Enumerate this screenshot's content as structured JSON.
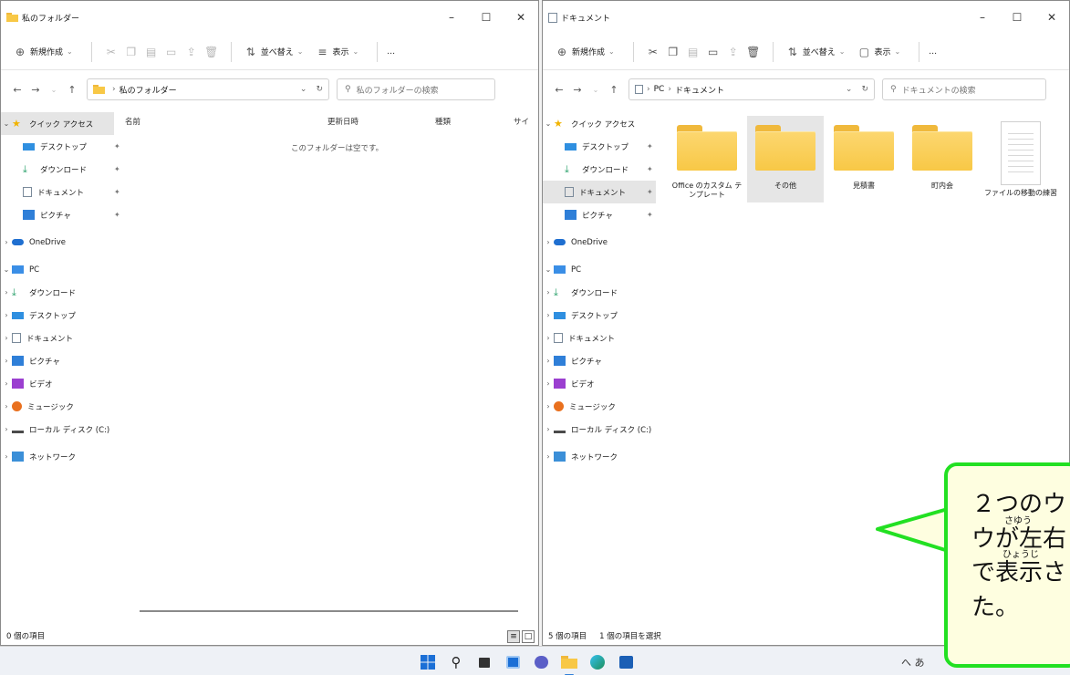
{
  "left_window": {
    "title": "私のフォルダー",
    "toolbar": {
      "new_label": "新規作成",
      "sort_label": "並べ替え",
      "view_label": "表示",
      "more_label": "…"
    },
    "address": {
      "path": [
        "私のフォルダー"
      ],
      "search_placeholder": "私のフォルダーの検索"
    },
    "columns": [
      "名前",
      "更新日時",
      "種類",
      "サイ"
    ],
    "empty_message": "このフォルダーは空です。",
    "status": "0 個の項目"
  },
  "right_window": {
    "title": "ドキュメント",
    "toolbar": {
      "new_label": "新規作成",
      "sort_label": "並べ替え",
      "view_label": "表示",
      "more_label": "…"
    },
    "address": {
      "path": [
        "PC",
        "ドキュメント"
      ],
      "search_placeholder": "ドキュメントの検索"
    },
    "files": [
      {
        "label": "Office のカスタム テンプレート",
        "type": "folder"
      },
      {
        "label": "その他",
        "type": "folder",
        "selected": true
      },
      {
        "label": "見積書",
        "type": "folder"
      },
      {
        "label": "町内会",
        "type": "folder"
      },
      {
        "label": "ファイルの移動の練習",
        "type": "document"
      }
    ],
    "status": "5 個の項目",
    "status_selected": "1 個の項目を選択"
  },
  "nav": {
    "quick_access": "クイック アクセス",
    "quick_items": [
      "デスクトップ",
      "ダウンロード",
      "ドキュメント",
      "ピクチャ"
    ],
    "onedrive": "OneDrive",
    "pc": "PC",
    "pc_items": [
      "ダウンロード",
      "デスクトップ",
      "ドキュメント",
      "ピクチャ",
      "ビデオ",
      "ミュージック",
      "ローカル ディスク (C:)"
    ],
    "network": "ネットワーク"
  },
  "taskbar": {
    "tray_text": "へ あ"
  },
  "callout": {
    "line1": "２つのウ",
    "line2": "ウが左右",
    "line3": "で表示さ",
    "line4": "た。",
    "ruby_sayuu": "さゆう",
    "ruby_hyouji": "ひょうじ"
  },
  "colors": {
    "accent": "#2f7fd8",
    "folder": "#f8c846",
    "callout_border": "#22e022",
    "callout_bg": "#fefee0"
  }
}
